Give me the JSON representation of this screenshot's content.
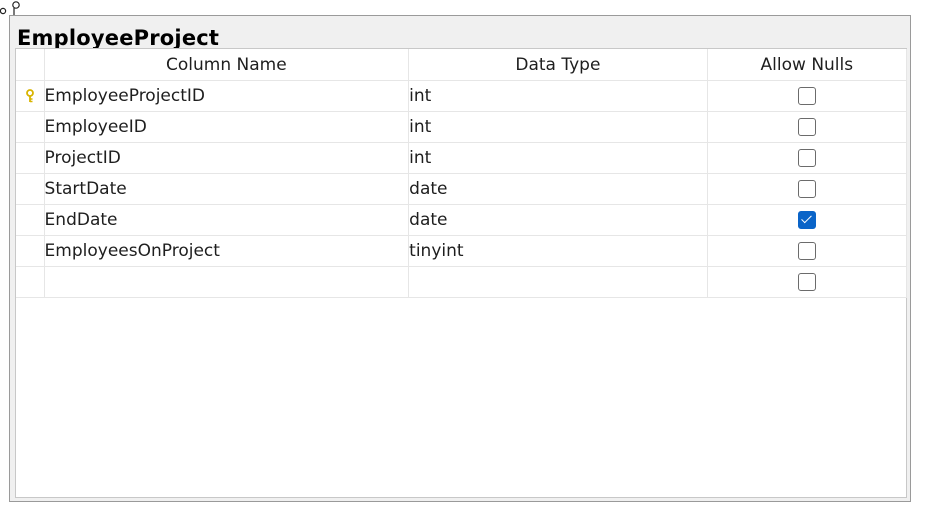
{
  "table": {
    "name": "EmployeeProject",
    "headers": {
      "column_name": "Column Name",
      "data_type": "Data Type",
      "allow_nulls": "Allow Nulls"
    },
    "rows": [
      {
        "column_name": "EmployeeProjectID",
        "data_type": "int",
        "allow_nulls": false,
        "primary_key": true
      },
      {
        "column_name": "EmployeeID",
        "data_type": "int",
        "allow_nulls": false,
        "primary_key": false
      },
      {
        "column_name": "ProjectID",
        "data_type": "int",
        "allow_nulls": false,
        "primary_key": false
      },
      {
        "column_name": "StartDate",
        "data_type": "date",
        "allow_nulls": false,
        "primary_key": false
      },
      {
        "column_name": "EndDate",
        "data_type": "date",
        "allow_nulls": true,
        "primary_key": false
      },
      {
        "column_name": "EmployeesOnProject",
        "data_type": "tinyint",
        "allow_nulls": false,
        "primary_key": false
      },
      {
        "column_name": "",
        "data_type": "",
        "allow_nulls": false,
        "primary_key": false
      }
    ]
  },
  "icons": {
    "key": "primary-key-icon",
    "connector": "relationship-connector-icon"
  },
  "colors": {
    "checked": "#0a64c8",
    "key": "#d8b400"
  }
}
